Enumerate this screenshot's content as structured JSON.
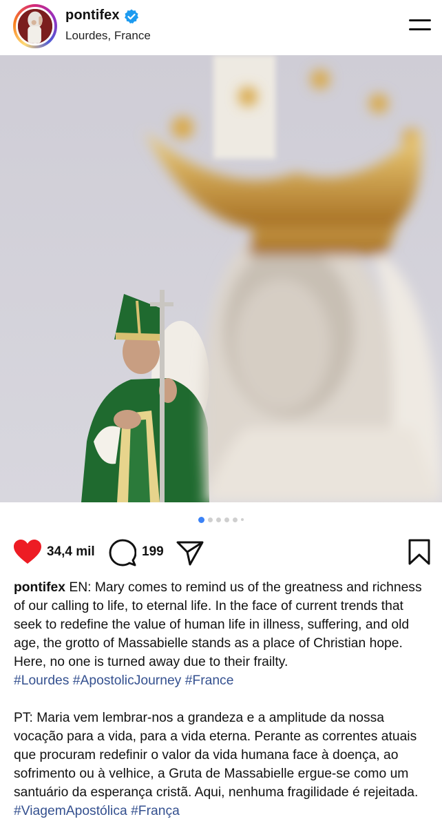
{
  "header": {
    "username": "pontifex",
    "location": "Lourdes, France",
    "verified_color": "#1d9bf0",
    "avatar_icon": "profile-avatar"
  },
  "post": {
    "image_alt_icon": "photo",
    "carousel": {
      "count": 6,
      "active_index": 0
    }
  },
  "actions": {
    "like_count": "34,4 mil",
    "comment_count": "199",
    "like_color": "#ed1c24",
    "liked": true
  },
  "caption": {
    "username": "pontifex",
    "en_text": " EN: Mary comes to remind us of the greatness and richness of our calling to life, to eternal life. In the face of current trends that seek to redefine the value of human life in illness, suffering, and old age, the grotto of Massabielle stands as a place of Christian hope. Here, no one is turned away due to their frailty.",
    "en_tags": [
      "#Lourdes",
      "#ApostolicJourney",
      "#France"
    ],
    "pt_text": "PT: Maria vem lembrar-nos a grandeza e a amplitude da nossa vocação para a vida, para a vida eterna. Perante as correntes atuais que procuram redefinir o valor da vida humana face à doença, ao sofrimento ou à velhice, a Gruta de Massabielle ergue-se como um santuário da esperança cristã. Aqui, nenhuma fragilidade é rejeitada.",
    "pt_tags": [
      "#ViagemApostólica",
      "#França"
    ],
    "link_color": "#34508f"
  }
}
